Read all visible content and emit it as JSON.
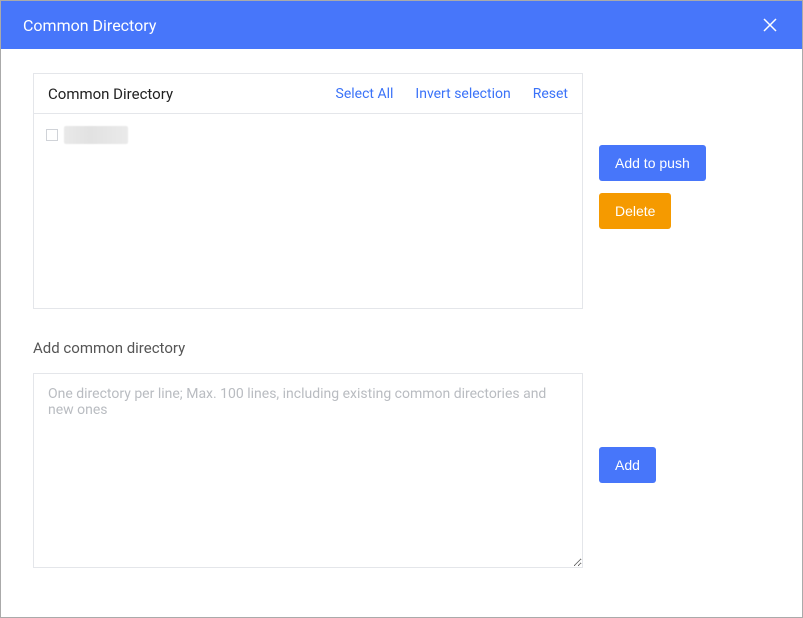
{
  "header": {
    "title": "Common Directory"
  },
  "panel": {
    "title": "Common Directory",
    "actions": {
      "select_all": "Select All",
      "invert_selection": "Invert selection",
      "reset": "Reset"
    },
    "items": [
      {
        "label": "",
        "checked": false
      }
    ]
  },
  "buttons": {
    "add_to_push": "Add to push",
    "delete": "Delete",
    "add": "Add"
  },
  "add_section": {
    "label": "Add common directory",
    "placeholder": "One directory per line; Max. 100 lines, including existing common directories and new ones",
    "value": ""
  }
}
